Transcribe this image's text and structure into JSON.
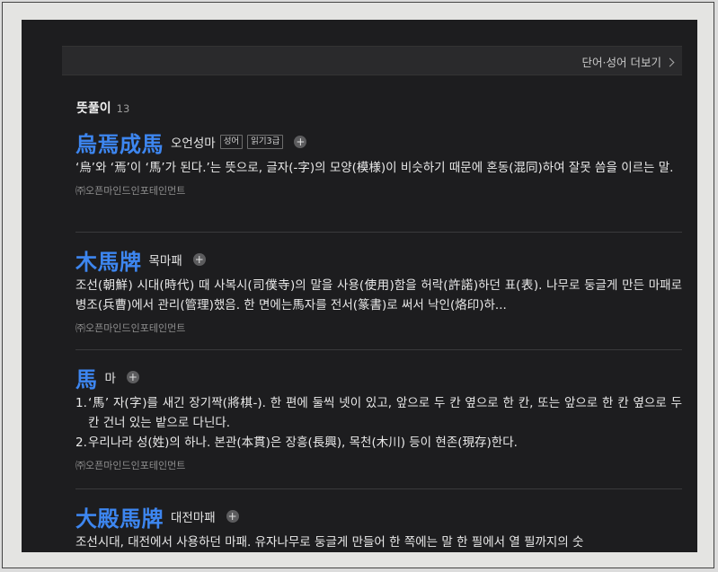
{
  "more_bar": {
    "label": "단어·성어 더보기"
  },
  "section": {
    "title": "뜻풀이",
    "count": "13"
  },
  "entries": [
    {
      "hanja": "烏焉成馬",
      "reading": "오언성마",
      "tags": [
        "성어",
        "읽기3급"
      ],
      "definition": "‘烏’와 ‘焉’이 ‘馬’가 된다.’는 뜻으로, 글자(-字)의 모양(模様)이 비슷하기 때문에 혼동(混同)하여 잘못 씀을 이르는 말.",
      "source": "㈜오픈마인드인포테인먼트"
    },
    {
      "hanja": "木馬牌",
      "reading": "목마패",
      "definition": "조선(朝鮮) 시대(時代) 때 사복시(司僕寺)의 말을 사용(使用)함을 허락(許諾)하던 표(表). 나무로 둥글게 만든 마패로 병조(兵曹)에서 관리(管理)했음. 한 면에는馬자를 전서(篆書)로 써서 낙인(烙印)하...",
      "source": "㈜오픈마인드인포테인먼트"
    },
    {
      "hanja": "馬",
      "reading": "마",
      "definitions": [
        {
          "num": "1.",
          "text": "‘馬’ 자(字)를 새긴 장기짝(將棋-). 한 편에 둘씩 넷이 있고, 앞으로 두 칸 옆으로 한 칸, 또는 앞으로 한 칸 옆으로 두 칸 건너 있는 밭으로 다닌다."
        },
        {
          "num": "2.",
          "text": "우리나라 성(姓)의 하나. 본관(本貫)은 장흥(長興), 목천(木川) 등이 현존(現存)한다."
        }
      ],
      "source": "㈜오픈마인드인포테인먼트"
    },
    {
      "hanja": "大殿馬牌",
      "reading": "대전마패",
      "definition": "조선시대, 대전에서 사용하던 마패. 유자나무로 둥글게 만들어 한 쪽에는 말 한 필에서 열 필까지의 숫"
    }
  ],
  "colors": {
    "accent": "#3d86f0",
    "panel_bg": "#1d1d1f"
  },
  "icons": {
    "add": "plus-circle-icon",
    "more": "chevron-right-icon"
  }
}
